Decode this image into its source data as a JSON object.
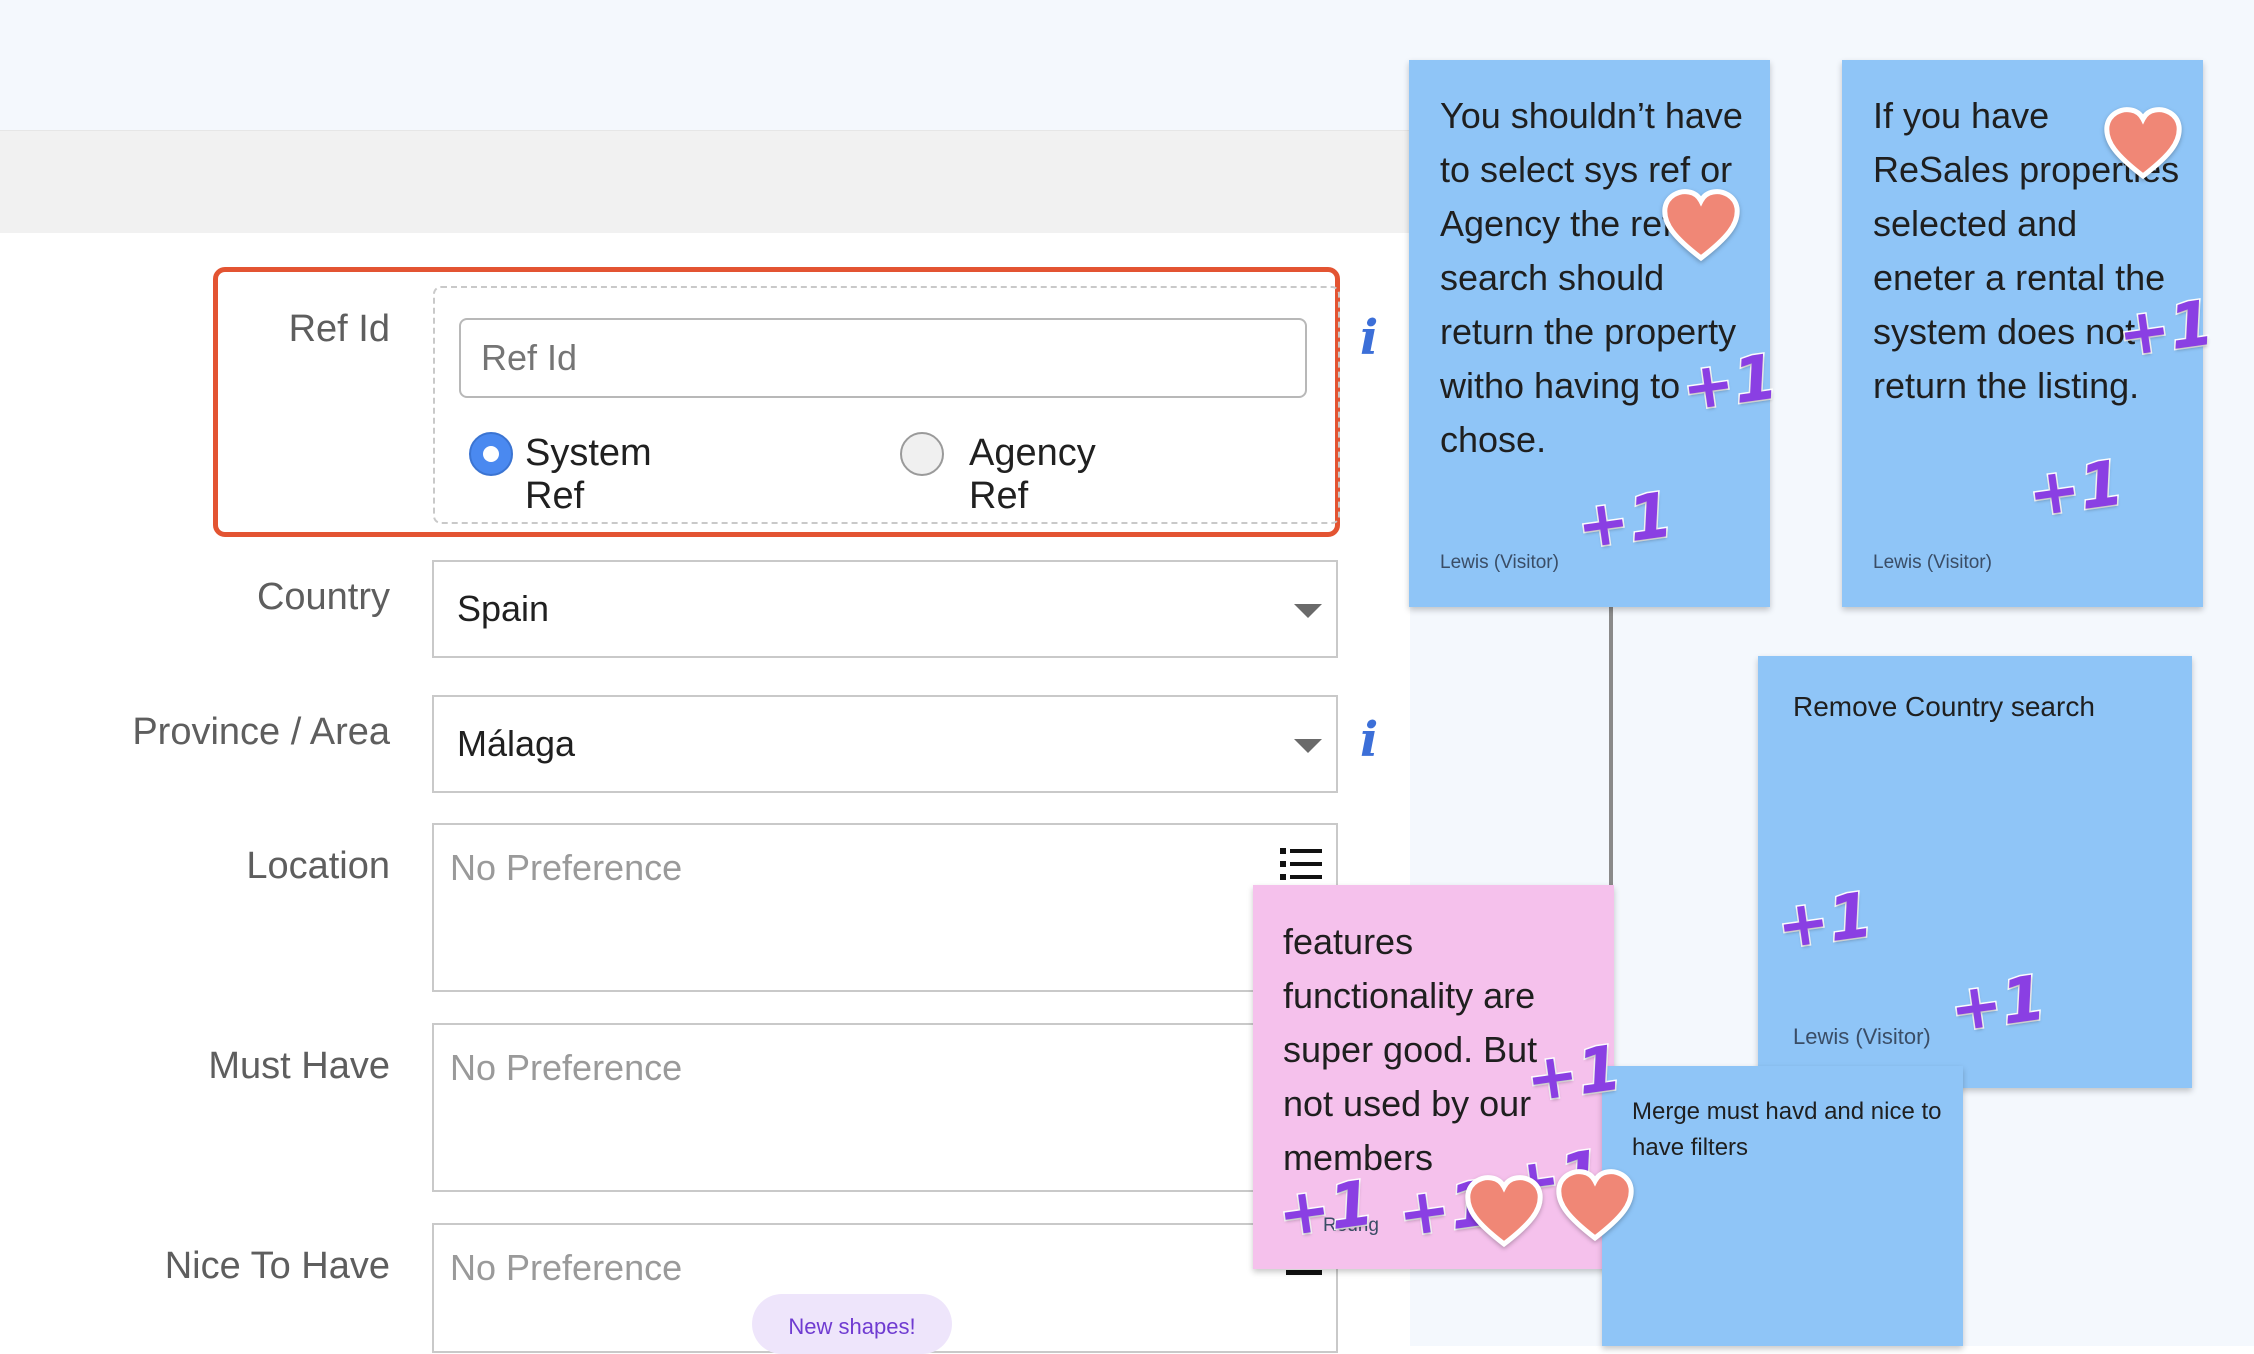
{
  "form": {
    "ref_id": {
      "label": "Ref Id",
      "placeholder": "Ref Id",
      "options": [
        {
          "label": "System Ref",
          "selected": true
        },
        {
          "label": "Agency Ref",
          "selected": false
        }
      ]
    },
    "country": {
      "label": "Country",
      "value": "Spain"
    },
    "province": {
      "label": "Province / Area",
      "value": "Málaga"
    },
    "location": {
      "label": "Location",
      "placeholder": "No Preference"
    },
    "must_have": {
      "label": "Must Have",
      "placeholder": "No Preference"
    },
    "nice_to_have": {
      "label": "Nice To Have",
      "placeholder": "No Preference"
    }
  },
  "stickies": [
    {
      "id": "sys-ref",
      "color": "#8fc5f7",
      "text": "You shouldn’t have to select sys ref or Agency the ref search should return the property witho having to chose.",
      "author": "Lewis (Visitor)"
    },
    {
      "id": "resales",
      "color": "#8fc5f7",
      "text": "If you have ReSales properties selected and eneter a rental the system does not return the listing.",
      "author": "Lewis (Visitor)"
    },
    {
      "id": "remove-country",
      "color": "#8fc5f7",
      "text": "Remove Country search",
      "author": "Lewis (Visitor)"
    },
    {
      "id": "features",
      "color": "#f5c1ec",
      "text": "features functionality are super good. But not used by our members",
      "author": "Rodrig"
    },
    {
      "id": "merge-filters",
      "color": "#8fc5f7",
      "text": "Merge must havd and nice to have filters"
    }
  ],
  "reactions": {
    "plus_one": "+1",
    "heart_color": "#f08776",
    "plus_color": "#8a3fe3"
  },
  "pill": {
    "label": "New shapes!"
  },
  "colors": {
    "ref_border": "#e35432",
    "radio_selected": "#4a89f0",
    "info_icon": "#3c6fd8"
  }
}
